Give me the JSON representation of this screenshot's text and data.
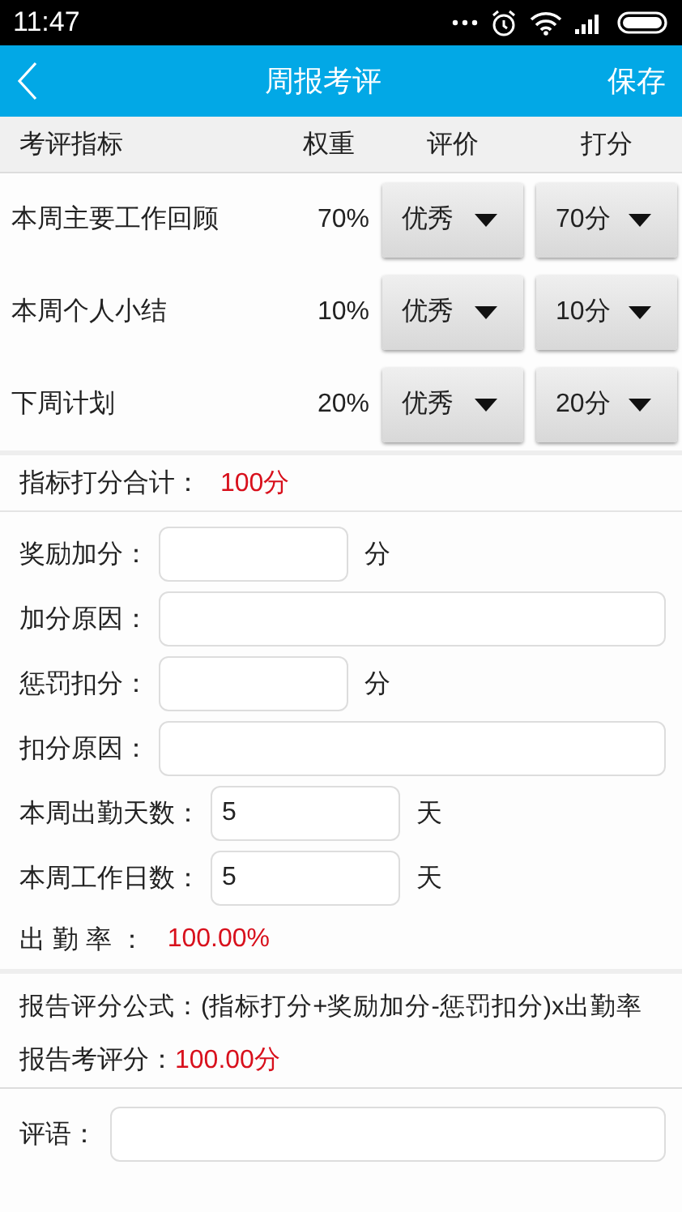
{
  "status_bar": {
    "time": "11:47"
  },
  "app_bar": {
    "title": "周报考评",
    "action": "保存"
  },
  "table": {
    "columns": [
      "考评指标",
      "权重",
      "评价",
      "打分"
    ],
    "rows": [
      {
        "name": "本周主要工作回顾",
        "weight": "70%",
        "rating": "优秀",
        "score": "70分"
      },
      {
        "name": "本周个人小结",
        "weight": "10%",
        "rating": "优秀",
        "score": "10分"
      },
      {
        "name": "下周计划",
        "weight": "20%",
        "rating": "优秀",
        "score": "20分"
      }
    ]
  },
  "total": {
    "label": "指标打分合计：",
    "value": "100分"
  },
  "fields": [
    {
      "kind": "short",
      "label": "奖励加分：",
      "unit": "分"
    },
    {
      "kind": "wide",
      "label": "加分原因："
    },
    {
      "kind": "short",
      "label": "惩罚扣分：",
      "unit": "分"
    },
    {
      "kind": "wide",
      "label": "扣分原因："
    },
    {
      "kind": "short",
      "label": "本周出勤天数：",
      "value": "5",
      "unit": "天"
    },
    {
      "kind": "short",
      "label": "本周工作日数：",
      "value": "5",
      "unit": "天"
    }
  ],
  "attendance": {
    "label": "出 勤 率 ：",
    "value": "100.00%"
  },
  "formula": "报告评分公式：(指标打分+奖励加分-惩罚扣分)x出勤率",
  "report_score": {
    "label": "报告考评分：",
    "value": "100.00分"
  },
  "comment": {
    "label": "评语："
  }
}
